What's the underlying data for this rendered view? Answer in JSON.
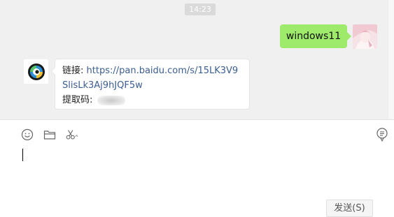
{
  "chat": {
    "timestamp": "14:23",
    "messages": [
      {
        "direction": "outgoing",
        "text": "windows11"
      },
      {
        "direction": "incoming",
        "link_prefix": "链接: ",
        "link_line1": "https://pan.baidu.com/s/15LK3V9",
        "link_line2": "SlisLk3Aj9hJQF5w",
        "code_label": "提取码: "
      }
    ]
  },
  "toolbar": {
    "icons": [
      "emoji-icon",
      "folder-icon",
      "scissors-icon",
      "chat-history-icon"
    ]
  },
  "input": {
    "value": ""
  },
  "send_button": {
    "label": "发送(S)"
  },
  "colors": {
    "outgoing_bubble": "#9eea6a",
    "message_area_bg": "#f0f0f0",
    "link": "#3b5d8f"
  }
}
